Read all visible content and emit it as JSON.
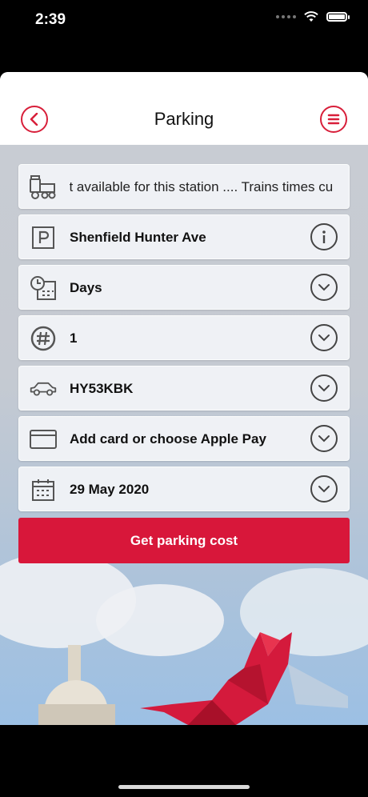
{
  "status": {
    "time": "2:39"
  },
  "header": {
    "title": "Parking"
  },
  "rows": [
    {
      "id": "trains",
      "text": "ot available for this station .... Trains times cu"
    },
    {
      "id": "station",
      "label": "Shenfield Hunter Ave"
    },
    {
      "id": "duration",
      "label": "Days"
    },
    {
      "id": "quantity",
      "label": "1"
    },
    {
      "id": "vehicle",
      "label": "HY53KBK"
    },
    {
      "id": "payment",
      "label": "Add card or choose Apple Pay"
    },
    {
      "id": "date",
      "label": "29 May 2020"
    }
  ],
  "cta": {
    "label": "Get parking cost"
  },
  "colors": {
    "accent": "#d8173a"
  },
  "icons": [
    "train-icon",
    "parking-icon",
    "clock-calendar-icon",
    "hash-icon",
    "car-icon",
    "card-icon",
    "calendar-icon",
    "info-icon",
    "chevron-down-icon",
    "back-icon",
    "menu-icon"
  ]
}
